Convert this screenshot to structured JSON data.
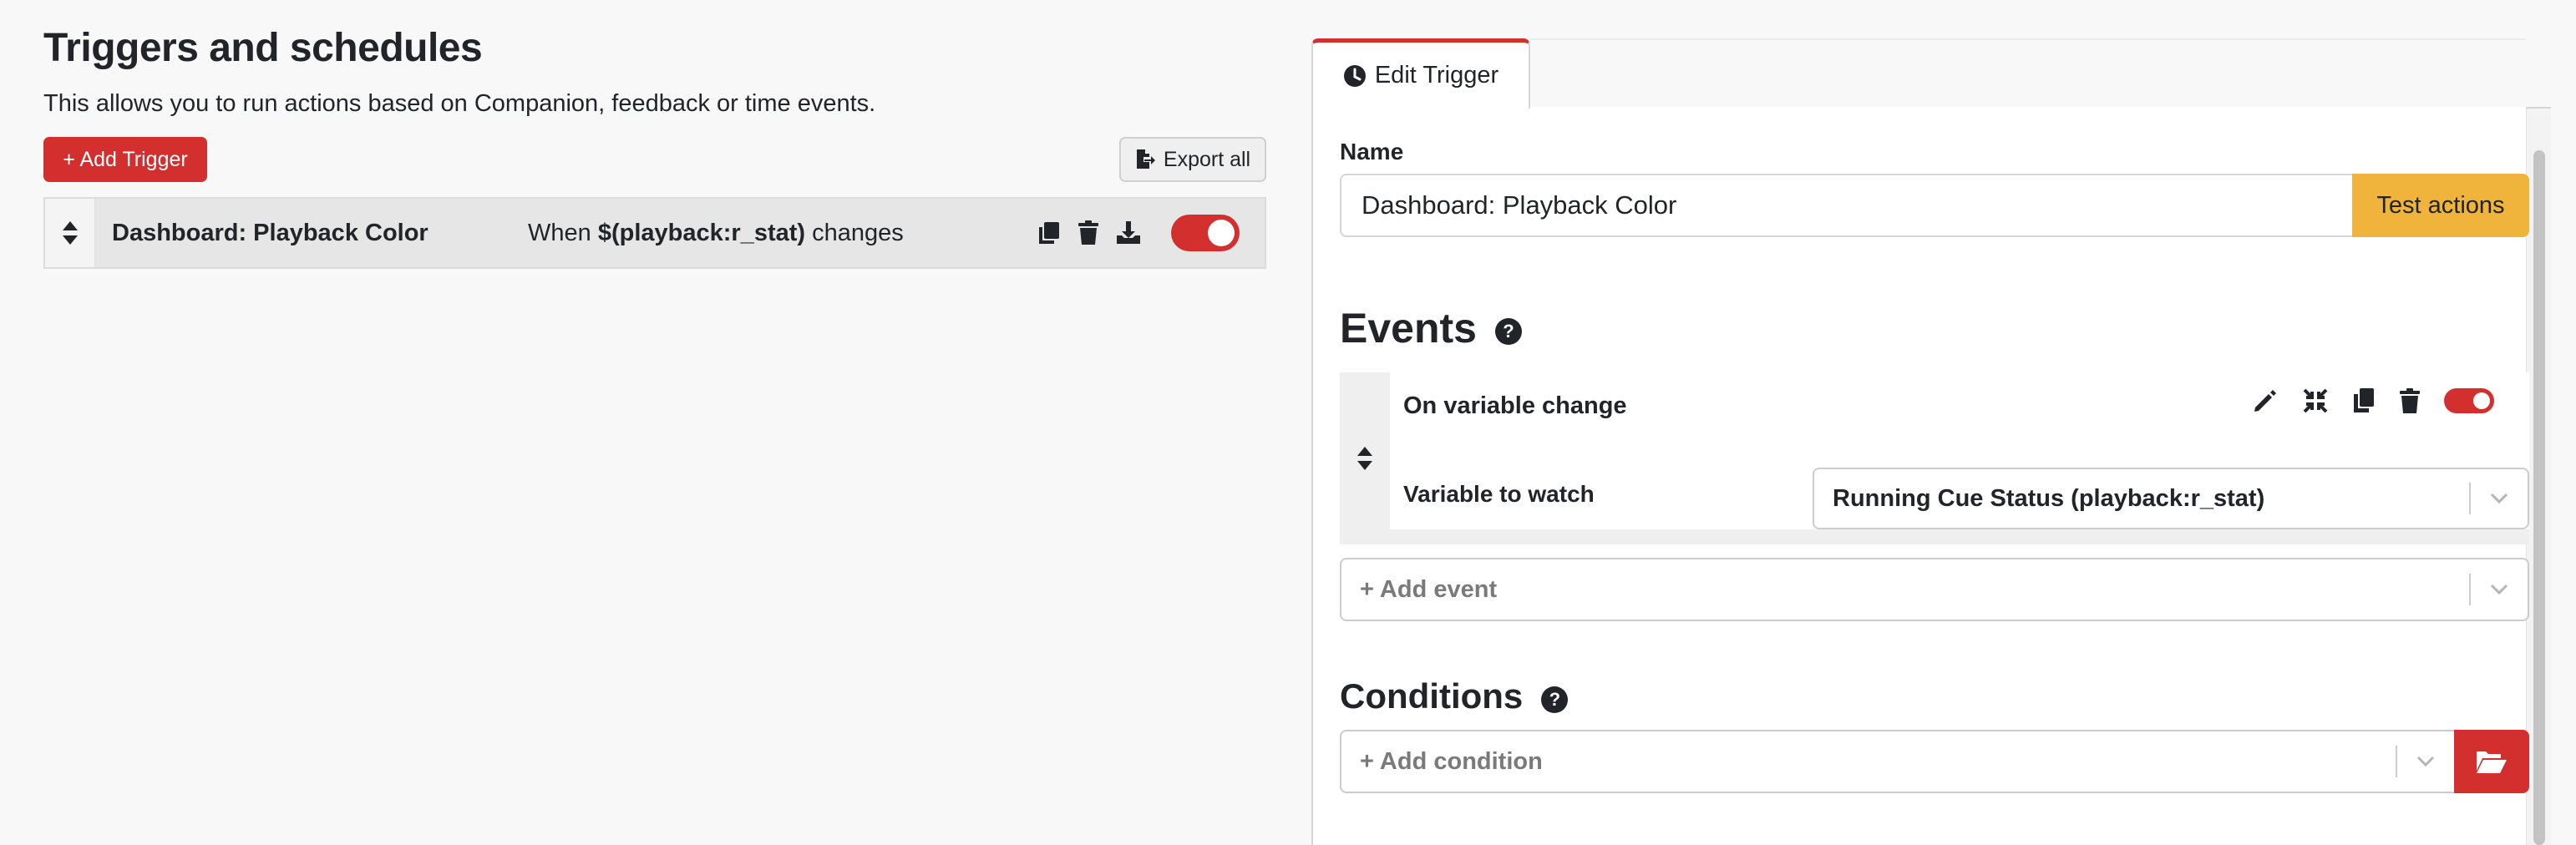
{
  "left": {
    "title": "Triggers and schedules",
    "description": "This allows you to run actions based on Companion, feedback or time events.",
    "add_trigger_label": "+ Add Trigger",
    "export_all_label": "Export all",
    "triggers": [
      {
        "name": "Dashboard: Playback Color",
        "desc_prefix": "When ",
        "desc_variable": "$(playback:r_stat)",
        "desc_suffix": " changes",
        "enabled": true
      }
    ]
  },
  "right": {
    "tab_label": "Edit Trigger",
    "name_label": "Name",
    "name_value": "Dashboard: Playback Color",
    "test_actions_label": "Test actions",
    "events_title": "Events",
    "help_glyph": "?",
    "event": {
      "title": "On variable change",
      "variable_label": "Variable to watch",
      "variable_value": "Running Cue Status (playback:r_stat)",
      "enabled": true
    },
    "add_event_placeholder": "+ Add event",
    "conditions_title": "Conditions",
    "add_condition_placeholder": "+ Add condition"
  },
  "colors": {
    "accent_red": "#d32f2f",
    "test_yellow": "#f0b33c",
    "background": "#f8f8f8"
  },
  "icons": [
    "sort-icon",
    "export-icon",
    "clone-icon",
    "trash-icon",
    "download-icon",
    "clock-icon",
    "help-icon",
    "pencil-icon",
    "compress-icon",
    "copy-icon",
    "chevron-down-icon",
    "folder-open-icon"
  ]
}
